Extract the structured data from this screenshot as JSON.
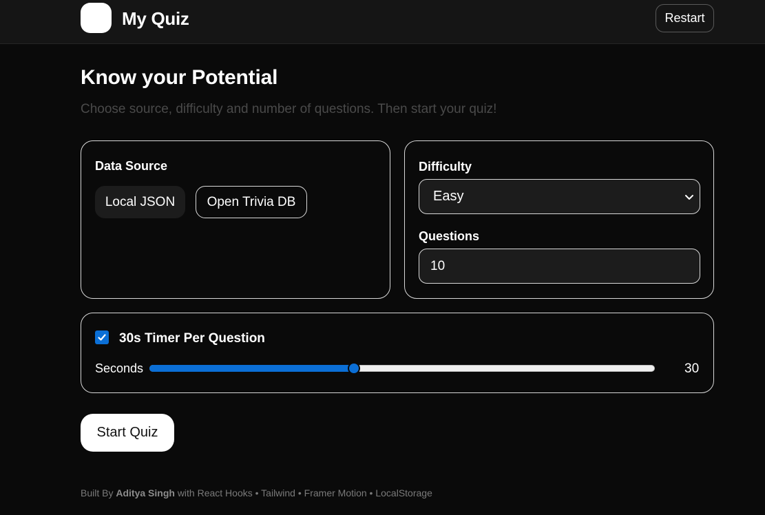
{
  "header": {
    "app_title": "My Quiz",
    "restart_label": "Restart"
  },
  "main": {
    "title": "Know your Potential",
    "subtitle": "Choose source, difficulty and number of questions. Then start your quiz!"
  },
  "data_source": {
    "label": "Data Source",
    "options": [
      "Local JSON",
      "Open Trivia DB"
    ],
    "selected": "Local JSON"
  },
  "settings": {
    "difficulty_label": "Difficulty",
    "difficulty_value": "Easy",
    "questions_label": "Questions",
    "questions_value": "10"
  },
  "timer": {
    "enabled": true,
    "label": "30s Timer Per Question",
    "seconds_label": "Seconds",
    "seconds_value": "30",
    "slider_fraction": 0.405
  },
  "actions": {
    "start_label": "Start Quiz"
  },
  "footer": {
    "prefix": "Built By",
    "author": "Aditya Singh",
    "suffix": "with React Hooks • Tailwind • Framer Motion • LocalStorage"
  },
  "colors": {
    "accent": "#0b6fd6",
    "background": "#0a0a0a",
    "header": "#151515"
  }
}
